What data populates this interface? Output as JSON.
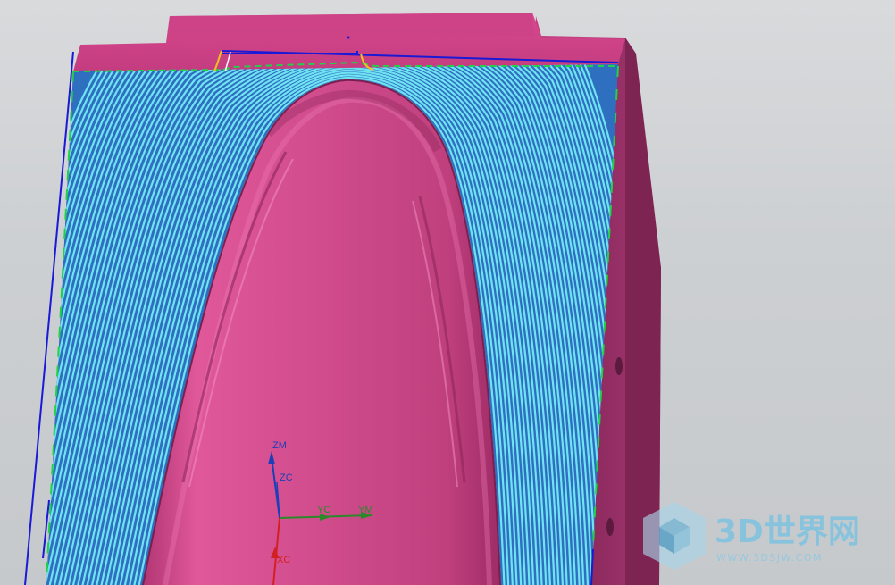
{
  "scene": {
    "description_hidden": true,
    "part_color": "#d2458a",
    "part_dark": "#a82e6a",
    "part_side": "#8c2a5c",
    "toolpath_cyan": "#6fe3f2",
    "toolpath_blue": "#2f6fc0",
    "boundary_green": "#22d14a",
    "boundary_blue": "#1a1ad6",
    "background": "#cfd2d5"
  },
  "triad": {
    "zm_label": "ZM",
    "zc_label": "ZC",
    "yc_label": "YC",
    "ym_label": "YM",
    "xc_label": "XC",
    "zm_color": "#1c3fb8",
    "zc_color": "#1c3fb8",
    "y_color": "#2a8a2a",
    "x_color": "#d22020"
  },
  "watermark": {
    "brand": "3D世界网",
    "url": "WWW.3DSJW.COM",
    "color": "#6fb8d8"
  }
}
